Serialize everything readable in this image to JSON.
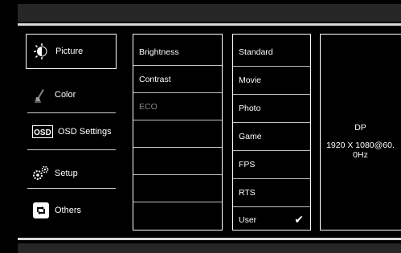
{
  "menu": [
    {
      "id": "picture",
      "label": "Picture",
      "icon": "picture-icon"
    },
    {
      "id": "color",
      "label": "Color",
      "icon": "color-icon"
    },
    {
      "id": "osd",
      "label": "OSD Settings",
      "icon": "osd-icon"
    },
    {
      "id": "setup",
      "label": "Setup",
      "icon": "setup-icon"
    },
    {
      "id": "others",
      "label": "Others",
      "icon": "others-icon"
    }
  ],
  "submenu": [
    {
      "label": "Brightness",
      "enabled": true
    },
    {
      "label": "Contrast",
      "enabled": true
    },
    {
      "label": "ECO",
      "enabled": false
    },
    {
      "label": "",
      "enabled": true
    },
    {
      "label": "",
      "enabled": true
    },
    {
      "label": "",
      "enabled": true
    },
    {
      "label": "",
      "enabled": true
    }
  ],
  "options": [
    {
      "label": "Standard",
      "selected": false
    },
    {
      "label": "Movie",
      "selected": false
    },
    {
      "label": "Photo",
      "selected": false
    },
    {
      "label": "Game",
      "selected": false
    },
    {
      "label": "FPS",
      "selected": false
    },
    {
      "label": "RTS",
      "selected": false
    },
    {
      "label": "User",
      "selected": true
    }
  ],
  "info": {
    "input": "DP",
    "resolution": "1920 X 1080@60. 0Hz"
  },
  "colors": {
    "background": "#000000",
    "bar": "#262626",
    "line": "#d8d8d8",
    "text": "#ffffff",
    "disabled": "#8a8a8a"
  }
}
